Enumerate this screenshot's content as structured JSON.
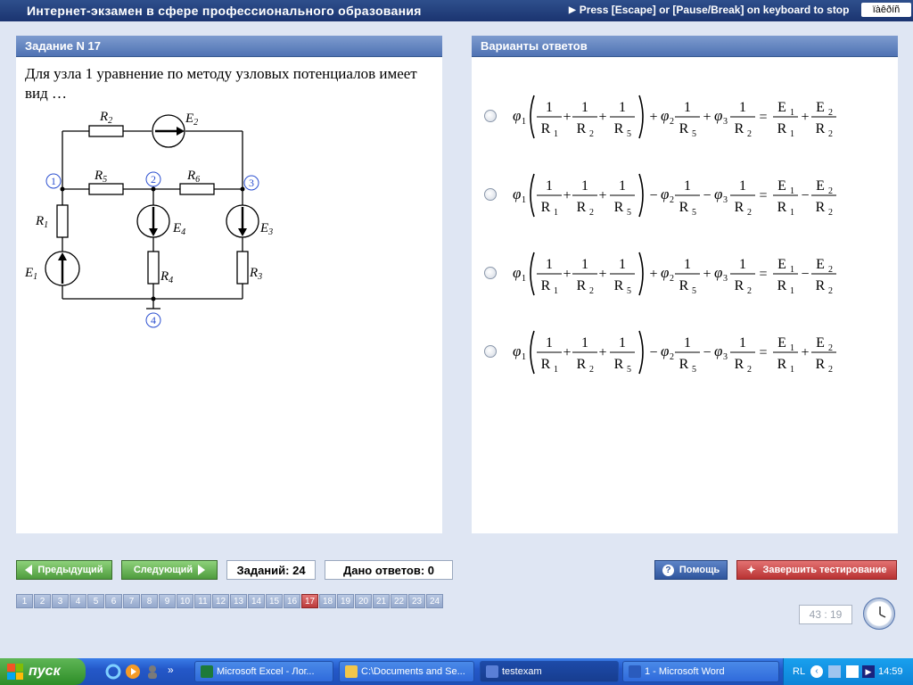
{
  "window": {
    "title": "Интернет-экзамен в сфере профессионального образования",
    "stop_hint": "Press [Escape] or [Pause/Break] on keyboard to stop",
    "kbd_indicator": "ïàêðíñ"
  },
  "task": {
    "header": "Задание N 17",
    "question": "Для узла 1 уравнение по методу узловых потенциалов имеет вид …",
    "circuit_labels": {
      "R1": "R",
      "R1_sub": "1",
      "R2": "R",
      "R2_sub": "2",
      "R3": "R",
      "R3_sub": "3",
      "R4": "R",
      "R4_sub": "4",
      "R5": "R",
      "R5_sub": "5",
      "R6": "R",
      "R6_sub": "6",
      "E1": "E",
      "E1_sub": "1",
      "E2": "E",
      "E2_sub": "2",
      "E3": "E",
      "E3_sub": "3",
      "E4": "E",
      "E4_sub": "4",
      "node1": "1",
      "node2": "2",
      "node3": "3",
      "node4": "4"
    }
  },
  "answers": {
    "header": "Варианты ответов",
    "options": [
      {
        "signs": [
          "+",
          "+",
          "+",
          "+",
          "+"
        ]
      },
      {
        "signs": [
          "+",
          "+",
          "−",
          "−",
          "−"
        ]
      },
      {
        "signs": [
          "+",
          "+",
          "+",
          "+",
          "−"
        ]
      },
      {
        "signs": [
          "+",
          "+",
          "−",
          "−",
          "+"
        ]
      }
    ],
    "symbols": {
      "phi": "φ",
      "one": "1",
      "R": "R",
      "E": "E",
      "eq": "=",
      "sub1": "1",
      "sub2": "2",
      "sub3": "3",
      "sub5": "5"
    }
  },
  "controls": {
    "prev": "Предыдущий",
    "next": "Следующий",
    "tasks_count": "Заданий: 24",
    "answers_given": "Дано ответов: 0",
    "help": "Помощь",
    "finish": "Завершить тестирование",
    "current_page": 17,
    "pages": [
      "1",
      "2",
      "3",
      "4",
      "5",
      "6",
      "7",
      "8",
      "9",
      "10",
      "11",
      "12",
      "13",
      "14",
      "15",
      "16",
      "17",
      "18",
      "19",
      "20",
      "21",
      "22",
      "23",
      "24"
    ],
    "timer": "43 : 19"
  },
  "taskbar": {
    "start": "пуск",
    "tasks": [
      {
        "label": "Microsoft Excel - Лог...",
        "icon": "excel-icon"
      },
      {
        "label": "C:\\Documents and Se...",
        "icon": "folder-icon"
      },
      {
        "label": "testexam",
        "icon": "testexam-icon"
      },
      {
        "label": "1 - Microsoft Word",
        "icon": "word-icon"
      }
    ],
    "lang": "RL",
    "time": "14:59"
  },
  "colors": {
    "title_bar": "#1b3470",
    "panel_header": "#4f72b3",
    "green_button": "#4e9b3d",
    "red_active": "#bb3b3b"
  }
}
